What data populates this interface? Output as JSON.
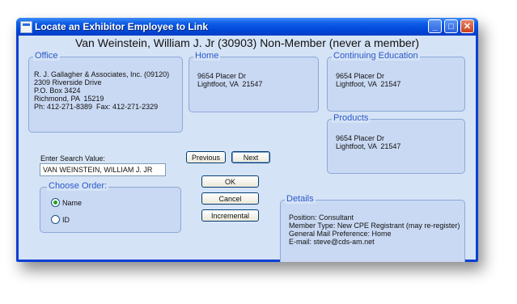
{
  "window": {
    "title": "Locate an Exhibitor Employee to Link",
    "controls": {
      "minimize": "_",
      "maximize": "□",
      "close": "✕"
    }
  },
  "header": {
    "title": "Van Weinstein, William J. Jr (30903) Non-Member (never a member)"
  },
  "office": {
    "label": "Office",
    "lines": "R. J. Gallagher & Associates, Inc. (09120)\n2309 Riverside Drive\nP.O. Box 3424\nRichmond, PA  15219\nPh: 412-271-8389  Fax: 412-271-2329"
  },
  "home": {
    "label": "Home",
    "lines": "9654 Placer Dr\nLightfoot, VA  21547"
  },
  "continuing_education": {
    "label": "Continuing Education",
    "lines": "9654 Placer Dr\nLightfoot, VA  21547"
  },
  "products": {
    "label": "Products",
    "lines": "9654 Placer Dr\nLightfoot, VA  21547"
  },
  "details": {
    "label": "Details",
    "lines": "Position: Consultant\nMember Type: New CPE Registrant (may re-register)\nGeneral Mail Preference: Home\nE-mail: steve@cds-am.net"
  },
  "search": {
    "label": "Enter Search Value:",
    "value": "VAN WEINSTEIN, WILLIAM J. JR"
  },
  "choose_order": {
    "label": "Choose Order:",
    "options": [
      {
        "label": "Name",
        "selected": true
      },
      {
        "label": "ID",
        "selected": false
      }
    ]
  },
  "buttons": {
    "previous": "Previous",
    "next": "Next",
    "ok": "OK",
    "cancel": "Cancel",
    "incremental": "Incremental"
  },
  "icons": [
    "app-icon",
    "minimize-icon",
    "maximize-icon",
    "close-icon"
  ],
  "colors": {
    "titlebar": "#0047d9",
    "client": "#d5e3f6",
    "group_label": "#2a58c9",
    "radio_selected": "#21a121"
  }
}
